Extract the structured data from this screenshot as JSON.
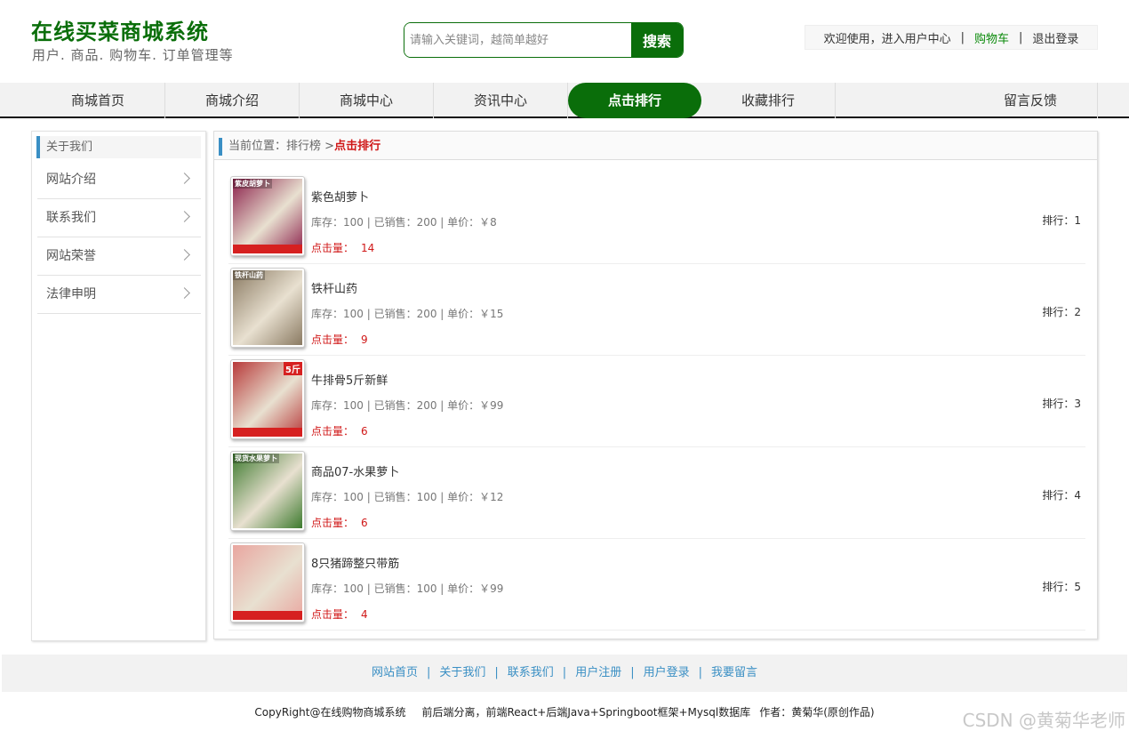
{
  "header": {
    "title": "在线买菜商城系统",
    "subtitle": "用户. 商品. 购物车. 订单管理等",
    "search_placeholder": "请输入关键词，越简单越好",
    "search_button": "搜索",
    "welcome": "欢迎使用，进入用户中心",
    "cart": "购物车",
    "logout": "退出登录",
    "sep": "|"
  },
  "nav": {
    "items": [
      "商城首页",
      "商城介绍",
      "商城中心",
      "资讯中心",
      "点击排行",
      "收藏排行",
      "留言反馈"
    ],
    "active_index": 4
  },
  "sidebar": {
    "title": "关于我们",
    "items": [
      "网站介绍",
      "联系我们",
      "网站荣誉",
      "法律申明"
    ]
  },
  "breadcrumb": {
    "prefix": "当前位置：",
    "parent": "排行榜",
    "arrow": ">",
    "current": "点击排行"
  },
  "products": [
    {
      "name": "紫色胡萝卜",
      "info": "库存：100 | 已销售：200 | 单价：￥8",
      "click_label": "点击量：",
      "clicks": "14",
      "rank": "排行：1",
      "img_label": "紫皮胡萝卜",
      "img_color": "#8b1f4a"
    },
    {
      "name": "铁杆山药",
      "info": "库存：100 | 已销售：200 | 单价：￥15",
      "click_label": "点击量：",
      "clicks": "9",
      "rank": "排行：2",
      "img_label": "铁杆山药",
      "img_color": "#8a7a62"
    },
    {
      "name": "牛排骨5斤新鲜",
      "info": "库存：100 | 已销售：200 | 单价：￥99",
      "click_label": "点击量：",
      "clicks": "6",
      "rank": "排行：3",
      "img_label": "5斤",
      "img_color": "#b83a3a"
    },
    {
      "name": "商品07-水果萝卜",
      "info": "库存：100 | 已销售：100 | 单价：￥12",
      "click_label": "点击量：",
      "clicks": "6",
      "rank": "排行：4",
      "img_label": "现货水果萝卜",
      "img_color": "#3d7a2e"
    },
    {
      "name": "8只猪蹄整只带筋",
      "info": "库存：100 | 已销售：100 | 单价：￥99",
      "click_label": "点击量：",
      "clicks": "4",
      "rank": "排行：5",
      "img_label": "",
      "img_color": "#e9a6a0"
    }
  ],
  "footer": {
    "links": [
      "网站首页",
      "关于我们",
      "联系我们",
      "用户注册",
      "用户登录",
      "我要留言"
    ],
    "sep": "|",
    "copyright": "CopyRight@在线购物商城系统",
    "tech": "前后端分离，前端React+后端Java+Springboot框架+Mysql数据库",
    "author": "作者：黄菊华(原创作品)",
    "watermark": "CSDN @黄菊华老师"
  },
  "colors": {
    "brand_green": "#0a6e0a",
    "accent_blue": "#3a8fc4",
    "accent_red": "#d01818"
  }
}
